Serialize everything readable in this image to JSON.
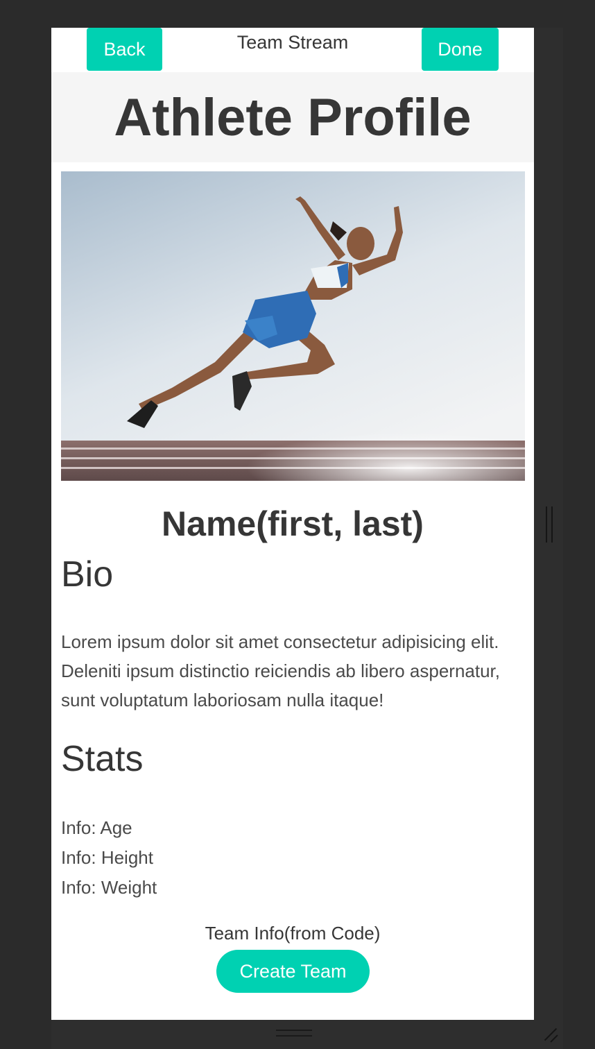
{
  "navbar": {
    "back_label": "Back",
    "title": "Team Stream",
    "done_label": "Done",
    "accent_color": "#00d1b2"
  },
  "hero": {
    "title": "Athlete Profile"
  },
  "athlete": {
    "photo_description_icon": "sprinter-photo",
    "name": "Name(first, last)"
  },
  "bio": {
    "heading": "Bio",
    "text": "Lorem ipsum dolor sit amet consectetur adipisicing elit. Deleniti ipsum distinctio reiciendis ab libero aspernatur, sunt voluptatum laboriosam nulla itaque!"
  },
  "stats": {
    "heading": "Stats",
    "items": [
      "Info: Age",
      "Info: Height",
      "Info: Weight"
    ]
  },
  "team": {
    "info": "Team Info(from Code)",
    "create_label": "Create Team"
  }
}
